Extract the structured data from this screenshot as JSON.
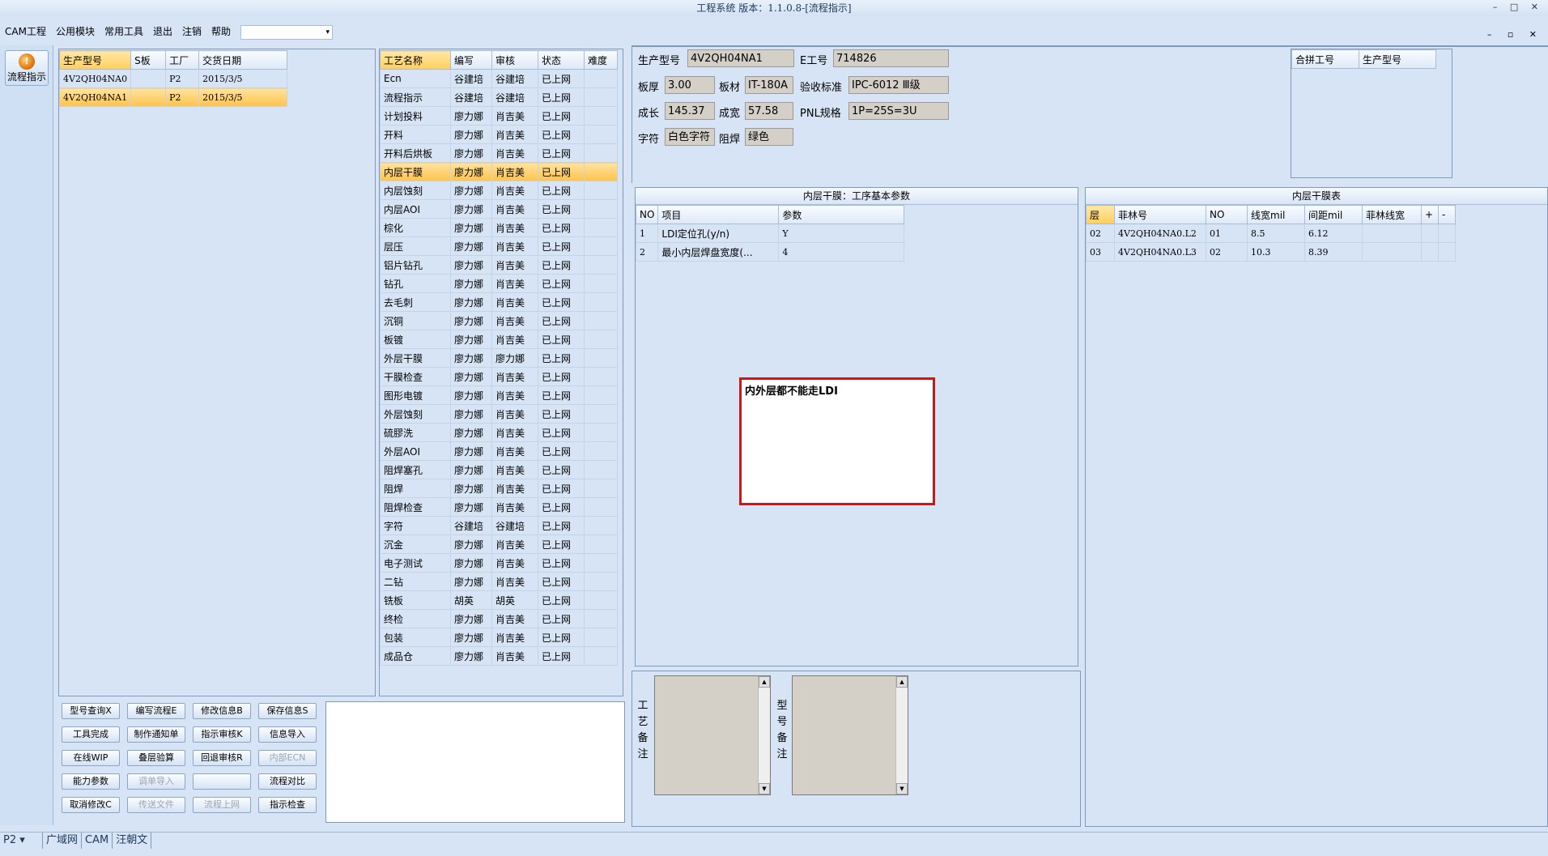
{
  "window": {
    "title": "工程系统 版本：1.1.0.8-[流程指示]"
  },
  "menu": {
    "items": [
      "CAM工程",
      "公用模块",
      "常用工具",
      "退出",
      "注销",
      "帮助"
    ],
    "combo_value": ""
  },
  "left_strip": {
    "flow_button_label": "流程指示"
  },
  "product_list": {
    "columns": [
      "生产型号",
      "S板",
      "工厂",
      "交货日期"
    ],
    "rows": [
      [
        "4V2QH04NA0",
        "",
        "P2",
        "2015/3/5"
      ],
      [
        "4V2QH04NA1",
        "",
        "P2",
        "2015/3/5"
      ]
    ],
    "selected_index": 1
  },
  "process_list": {
    "columns": [
      "工艺名称",
      "编写",
      "审核",
      "状态",
      "难度"
    ],
    "rows": [
      [
        "Ecn",
        "谷建培",
        "谷建培",
        "已上网",
        ""
      ],
      [
        "流程指示",
        "谷建培",
        "谷建培",
        "已上网",
        ""
      ],
      [
        "计划投料",
        "廖力娜",
        "肖吉美",
        "已上网",
        ""
      ],
      [
        "开料",
        "廖力娜",
        "肖吉美",
        "已上网",
        ""
      ],
      [
        "开料后烘板",
        "廖力娜",
        "肖吉美",
        "已上网",
        ""
      ],
      [
        "内层干膜",
        "廖力娜",
        "肖吉美",
        "已上网",
        ""
      ],
      [
        "内层蚀刻",
        "廖力娜",
        "肖吉美",
        "已上网",
        ""
      ],
      [
        "内层AOI",
        "廖力娜",
        "肖吉美",
        "已上网",
        ""
      ],
      [
        "棕化",
        "廖力娜",
        "肖吉美",
        "已上网",
        ""
      ],
      [
        "层压",
        "廖力娜",
        "肖吉美",
        "已上网",
        ""
      ],
      [
        "铝片钻孔",
        "廖力娜",
        "肖吉美",
        "已上网",
        ""
      ],
      [
        "钻孔",
        "廖力娜",
        "肖吉美",
        "已上网",
        ""
      ],
      [
        "去毛刺",
        "廖力娜",
        "肖吉美",
        "已上网",
        ""
      ],
      [
        "沉铜",
        "廖力娜",
        "肖吉美",
        "已上网",
        ""
      ],
      [
        "板镀",
        "廖力娜",
        "肖吉美",
        "已上网",
        ""
      ],
      [
        "外层干膜",
        "廖力娜",
        "廖力娜",
        "已上网",
        ""
      ],
      [
        "干膜检查",
        "廖力娜",
        "肖吉美",
        "已上网",
        ""
      ],
      [
        "图形电镀",
        "廖力娜",
        "肖吉美",
        "已上网",
        ""
      ],
      [
        "外层蚀刻",
        "廖力娜",
        "肖吉美",
        "已上网",
        ""
      ],
      [
        "硫膠洗",
        "廖力娜",
        "肖吉美",
        "已上网",
        ""
      ],
      [
        "外层AOI",
        "廖力娜",
        "肖吉美",
        "已上网",
        ""
      ],
      [
        "阻焊塞孔",
        "廖力娜",
        "肖吉美",
        "已上网",
        ""
      ],
      [
        "阻焊",
        "廖力娜",
        "肖吉美",
        "已上网",
        ""
      ],
      [
        "阻焊检查",
        "廖力娜",
        "肖吉美",
        "已上网",
        ""
      ],
      [
        "字符",
        "谷建培",
        "谷建培",
        "已上网",
        ""
      ],
      [
        "沉金",
        "廖力娜",
        "肖吉美",
        "已上网",
        ""
      ],
      [
        "电子测试",
        "廖力娜",
        "肖吉美",
        "已上网",
        ""
      ],
      [
        "二钻",
        "廖力娜",
        "肖吉美",
        "已上网",
        ""
      ],
      [
        "铣板",
        "胡英",
        "胡英",
        "已上网",
        ""
      ],
      [
        "终检",
        "廖力娜",
        "肖吉美",
        "已上网",
        ""
      ],
      [
        "包装",
        "廖力娜",
        "肖吉美",
        "已上网",
        ""
      ],
      [
        "成品仓",
        "廖力娜",
        "肖吉美",
        "已上网",
        ""
      ]
    ],
    "selected_index": 5
  },
  "buttons": {
    "rows": [
      [
        "型号查询X",
        "编写流程E",
        "修改信息B",
        "保存信息S"
      ],
      [
        "工具完成",
        "制作通知单",
        "指示审核K",
        "信息导入"
      ],
      [
        "在线WIP",
        "叠层验算",
        "回退审核R",
        "内部ECN"
      ],
      [
        "能力参数",
        "调单导入",
        "",
        "流程对比"
      ],
      [
        "取消修改C",
        "传送文件",
        "流程上网",
        "指示检查"
      ]
    ]
  },
  "info": {
    "product_label": "生产型号",
    "product_value": "4V2QH04NA1",
    "eno_label": "E工号",
    "eno_value": "714826",
    "thickness_label": "板厚",
    "thickness_value": "3.00",
    "material_label": "板材",
    "material_value": "IT-180A",
    "standard_label": "验收标准",
    "standard_value": "IPC-6012 Ⅲ级",
    "length_label": "成长",
    "length_value": "145.37",
    "width_label": "成宽",
    "width_value": "57.58",
    "pnl_label": "PNL规格",
    "pnl_value": "1P=25S=3U",
    "char_label": "字符",
    "char_value": "白色字符",
    "mask_label": "阻焊",
    "mask_value": "绿色"
  },
  "merge_table": {
    "columns": [
      "合拼工号",
      "生产型号"
    ]
  },
  "params": {
    "title": "内层干膜：工序基本参数",
    "columns": [
      "NO",
      "项目",
      "参数"
    ],
    "rows": [
      [
        "1",
        "LDI定位孔(y/n)",
        "Y"
      ],
      [
        "2",
        "最小内层焊盘宽度(...",
        "4"
      ]
    ],
    "note": "内外层都不能走LDI"
  },
  "film_table": {
    "title": "内层干膜表",
    "columns": [
      "层",
      "菲林号",
      "NO",
      "线宽mil",
      "间距mil",
      "菲林线宽",
      "+",
      "-"
    ],
    "rows": [
      [
        "02",
        "4V2QH04NA0.L2",
        "01",
        "8.5",
        "6.12",
        "",
        "",
        ""
      ],
      [
        "03",
        "4V2QH04NA0.L3",
        "02",
        "10.3",
        "8.39",
        "",
        "",
        ""
      ]
    ]
  },
  "remarks": {
    "process_label": "工艺备注",
    "model_label": "型号备注"
  },
  "taskbar": {
    "items": [
      "P2",
      "广域网",
      "CAM",
      "汪朝文"
    ]
  }
}
